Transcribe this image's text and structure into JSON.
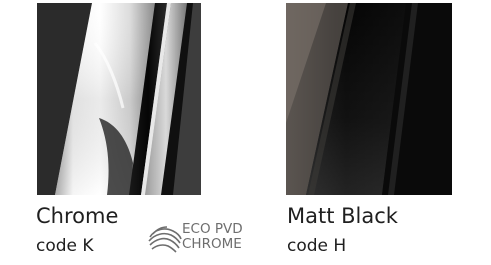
{
  "finishes": [
    {
      "name": "Chrome",
      "code": "code K"
    },
    {
      "name": "Matt Black",
      "code": "code H"
    }
  ],
  "eco_logo": {
    "line1": "ECO PVD",
    "line2": "CHROME"
  },
  "colors": {
    "text": "#1f1f1f",
    "logo_gray": "#6e6e6e",
    "chrome_light": "#e6e6e6",
    "matt_black": "#0b0b0b"
  },
  "icons": {
    "eco_mark": "wave-swirl-icon"
  }
}
